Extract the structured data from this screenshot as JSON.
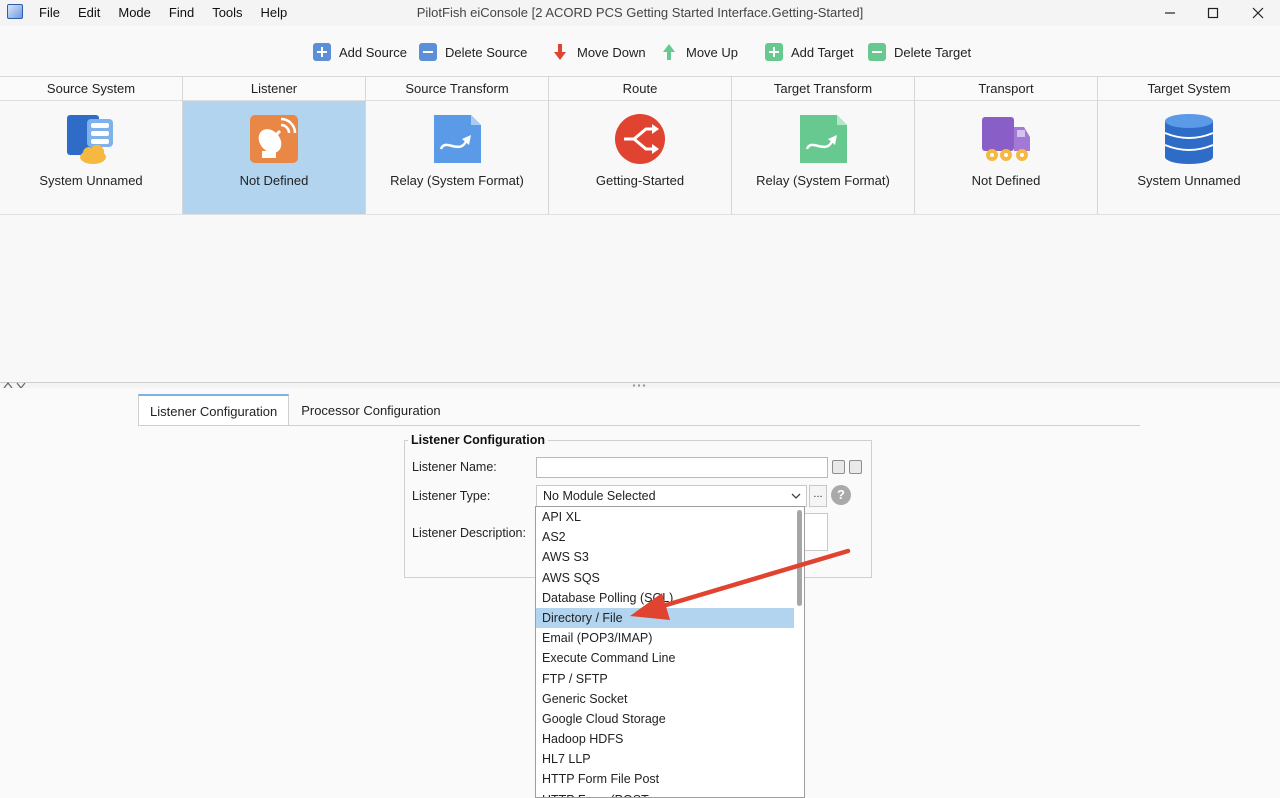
{
  "window": {
    "title": "PilotFish eiConsole [2 ACORD PCS Getting Started Interface.Getting-Started]"
  },
  "menu": [
    "File",
    "Edit",
    "Mode",
    "Find",
    "Tools",
    "Help"
  ],
  "toolbar": {
    "add_source": "Add Source",
    "delete_source": "Delete Source",
    "move_down": "Move Down",
    "move_up": "Move Up",
    "add_target": "Add Target",
    "delete_target": "Delete Target"
  },
  "stages": [
    {
      "header": "Source System",
      "label": "System Unnamed",
      "icon": "system-cloud-icon"
    },
    {
      "header": "Listener",
      "label": "Not Defined",
      "icon": "satellite-dish-icon",
      "selected": true
    },
    {
      "header": "Source Transform",
      "label": "Relay (System Format)",
      "icon": "relay-document-icon"
    },
    {
      "header": "Route",
      "label": "Getting-Started",
      "icon": "route-icon"
    },
    {
      "header": "Target Transform",
      "label": "Relay (System Format)",
      "icon": "relay-document-icon"
    },
    {
      "header": "Transport",
      "label": "Not Defined",
      "icon": "truck-icon"
    },
    {
      "header": "Target System",
      "label": "System Unnamed",
      "icon": "database-icon"
    }
  ],
  "tabs": {
    "listener_config": "Listener Configuration",
    "processor_config": "Processor Configuration"
  },
  "form": {
    "group_title": "Listener Configuration",
    "name_label": "Listener Name:",
    "name_value": "",
    "type_label": "Listener Type:",
    "type_value": "No Module Selected",
    "dots": "...",
    "help": "?",
    "description_label": "Listener Description:"
  },
  "dropdown": {
    "selected": "Directory / File",
    "options": [
      "API XL",
      "AS2",
      "AWS S3",
      "AWS SQS",
      "Database Polling (SQL)",
      "Directory / File",
      "Email (POP3/IMAP)",
      "Execute Command Line",
      "FTP / SFTP",
      "Generic Socket",
      "Google Cloud Storage",
      "Hadoop HDFS",
      "HL7 LLP",
      "HTTP Form File Post",
      "HTTP Form (POST"
    ]
  },
  "colors": {
    "selection": "#b2d4ef",
    "annotation_arrow": "#e0432f",
    "add_icon": "#5b8fd8",
    "move_down_icon": "#e0432f",
    "move_up_icon": "#67c98f"
  }
}
